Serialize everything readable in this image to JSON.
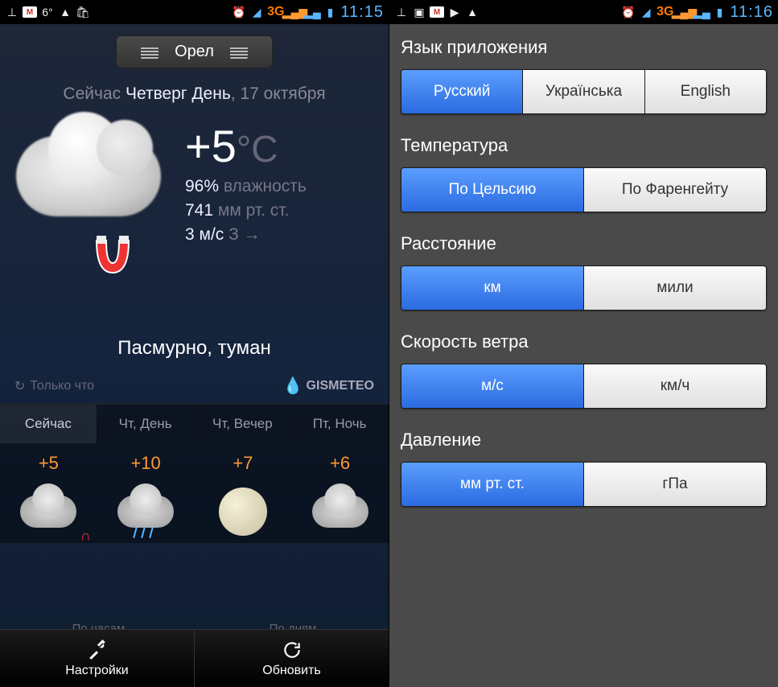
{
  "statusbar": {
    "temp": "6°",
    "network": "3G",
    "time1": "11:15",
    "time2": "11:16"
  },
  "weather": {
    "location": "Орел",
    "date_prefix": "Сейчас",
    "date_main": "Четверг День",
    "date_suffix": ", 17 октября",
    "temp": "+5",
    "temp_unit": "°C",
    "humidity_val": "96%",
    "humidity_lbl": " влажность",
    "pressure_val": "741",
    "pressure_lbl": " мм рт. ст.",
    "wind_val": "3 м/с",
    "wind_dir": " З →",
    "description": "Пасмурно, туман",
    "updated": "Только что",
    "brand": "GISMETEO",
    "overlay_hourly": "По часам",
    "overlay_daily": "По дням"
  },
  "forecast": {
    "tabs": [
      {
        "label": "Сейчас",
        "temp": "+5",
        "active": true
      },
      {
        "label": "Чт, День",
        "temp": "+10"
      },
      {
        "label": "Чт, Вечер",
        "temp": "+7"
      },
      {
        "label": "Пт, Ночь",
        "temp": "+6"
      }
    ]
  },
  "bottomnav": {
    "settings": "Настройки",
    "refresh": "Обновить"
  },
  "settings": {
    "sections": [
      {
        "title": "Язык приложения",
        "options": [
          "Русский",
          "Українська",
          "English"
        ],
        "active": 0
      },
      {
        "title": "Температура",
        "options": [
          "По Цельсию",
          "По Фаренгейту"
        ],
        "active": 0
      },
      {
        "title": "Расстояние",
        "options": [
          "км",
          "мили"
        ],
        "active": 0
      },
      {
        "title": "Скорость ветра",
        "options": [
          "м/с",
          "км/ч"
        ],
        "active": 0
      },
      {
        "title": "Давление",
        "options": [
          "мм рт. ст.",
          "гПа"
        ],
        "active": 0
      }
    ]
  }
}
